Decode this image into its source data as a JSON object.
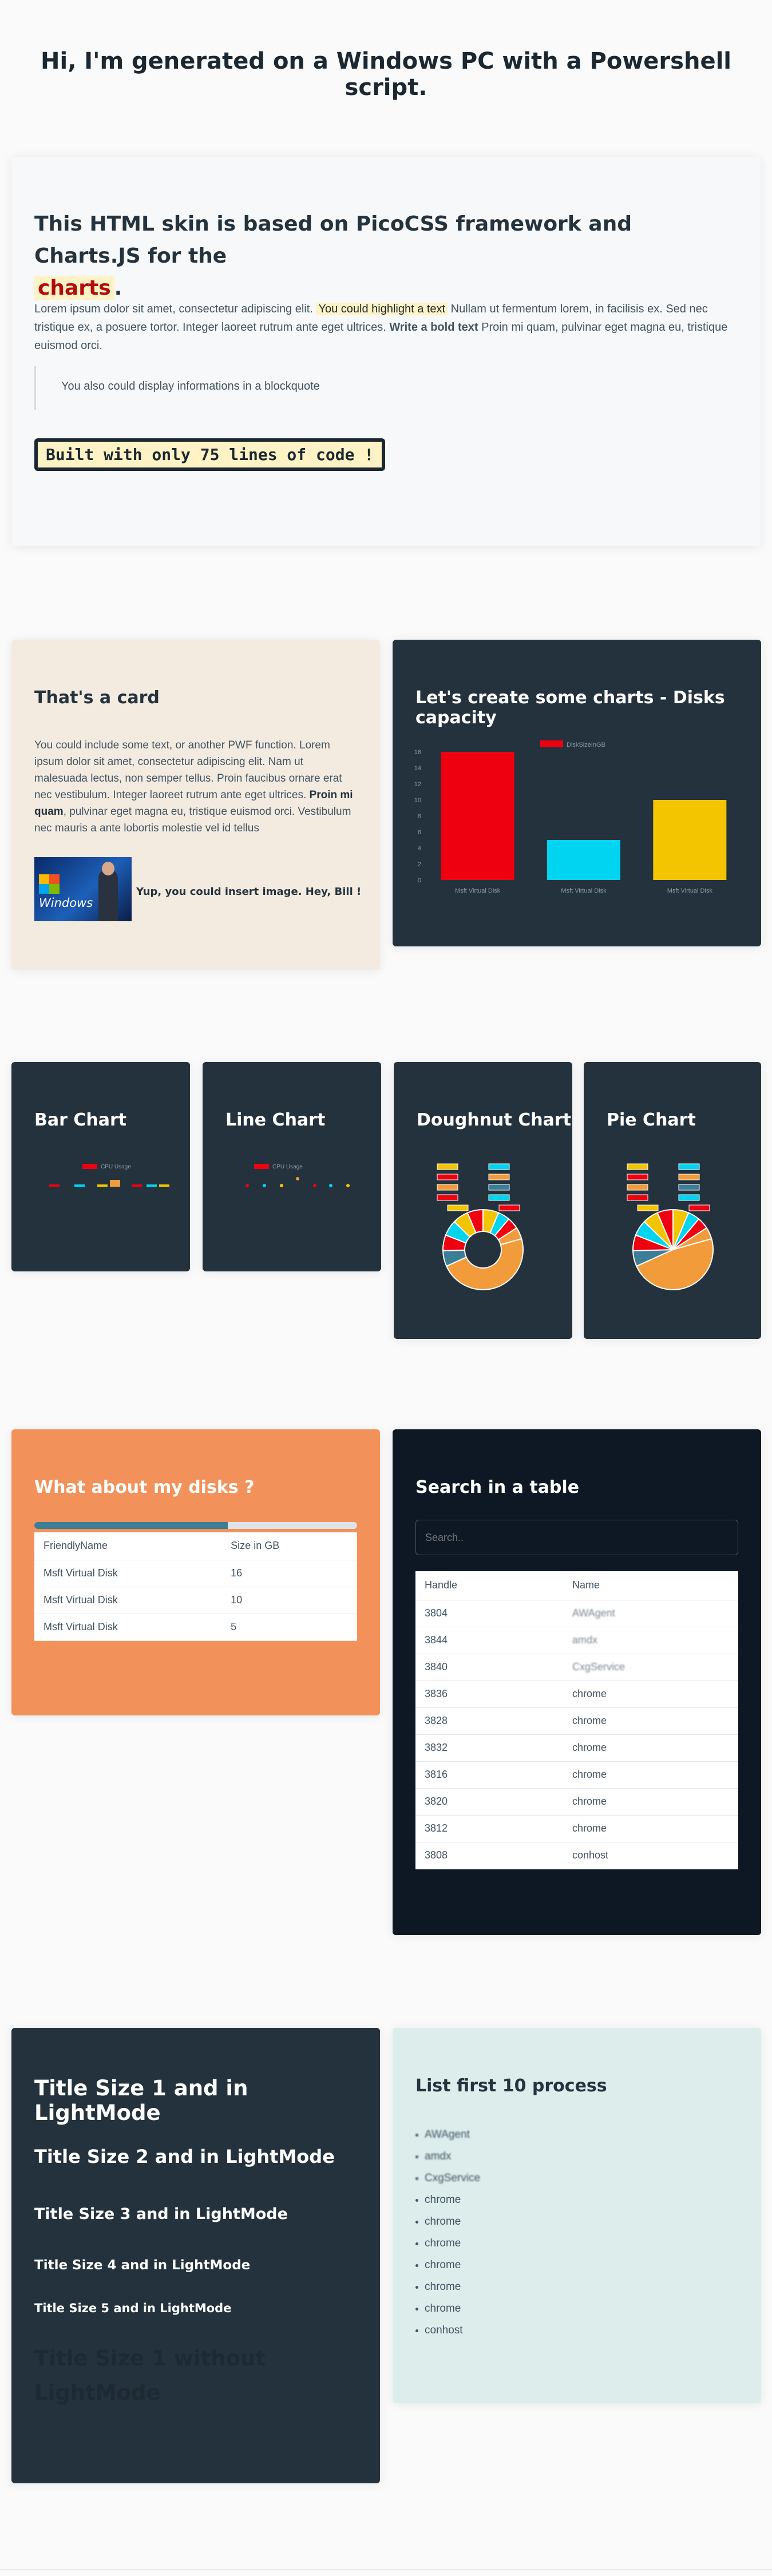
{
  "page_title": "Hi, I'm generated on a Windows PC with a Powershell script.",
  "hero": {
    "title_prefix": "This HTML skin is based on",
    "title_pico": "PicoCSS framework",
    "title_and": "and",
    "title_chartjs": "Charts.JS",
    "title_for": "for the",
    "title_charts": "charts",
    "title_dot": ".",
    "para_1": "Lorem ipsum dolor sit amet, consectetur adipiscing elit.",
    "para_highlight": "You could highlight a text",
    "para_2": "Nullam ut fermentum lorem, in facilisis ex. Sed nec tristique ex, a posuere tortor. Integer laoreet rutrum ante eget ultrices.",
    "para_bold": "Write a bold text",
    "para_3": "Proin mi quam, pulvinar eget magna eu, tristique euismod orci.",
    "blockquote": "You also could display informations in a blockquote",
    "code": "Built with only 75 lines of code !"
  },
  "card1": {
    "title": "That's a card",
    "text_1": "You could include some text, or another PWF function. Lorem ipsum dolor sit amet, consectetur adipiscing elit. Nam ut malesuada lectus, non semper tellus. Proin faucibus ornare erat nec vestibulum. Integer laoreet rutrum ante eget ultrices.",
    "text_bold": "Proin mi quam",
    "text_2": ", pulvinar eget magna eu, tristique euismod orci. Vestibulum nec mauris a ante lobortis molestie vel id tellus",
    "image_text": "Windows",
    "image_caption": "Yup, you could insert image. Hey, Bill !"
  },
  "disk_chart": {
    "title": "Let's create some charts - Disks capacity",
    "legend": "DiskSizeInGB",
    "color_primary": "#ef0010"
  },
  "chart_data": [
    {
      "type": "bar",
      "title": "Let's create some charts - Disks capacity",
      "series": [
        {
          "name": "DiskSizeInGB",
          "values": [
            16,
            5,
            10
          ]
        }
      ],
      "categories": [
        "Msft Virtual Disk",
        "Msft Virtual Disk",
        "Msft Virtual Disk"
      ],
      "colors": [
        "#ef0010",
        "#00d4f0",
        "#f2c500"
      ],
      "ylim": [
        0,
        16
      ],
      "yticks": [
        "0",
        "2",
        "4",
        "6",
        "8",
        "10",
        "12",
        "14",
        "16"
      ],
      "grid": false,
      "legend": "top"
    }
  ],
  "small_charts": [
    {
      "title": "Bar Chart",
      "legend": "CPU Usage"
    },
    {
      "title": "Line Chart",
      "legend": "CPU Usage"
    },
    {
      "title": "Doughnut Chart"
    },
    {
      "title": "Pie Chart"
    }
  ],
  "disks_card": {
    "title": "What about my disks ?",
    "progress": 0.6,
    "headers": [
      "FriendlyName",
      "Size in GB"
    ],
    "rows": [
      [
        "Msft Virtual Disk",
        "16"
      ],
      [
        "Msft Virtual Disk",
        "10"
      ],
      [
        "Msft Virtual Disk",
        "5"
      ]
    ]
  },
  "search_card": {
    "title": "Search in a table",
    "placeholder": "Search..",
    "headers": [
      "Handle",
      "Name"
    ],
    "rows": [
      [
        "3804",
        "AWAgent"
      ],
      [
        "3844",
        "amdx"
      ],
      [
        "3840",
        "CxgService"
      ],
      [
        "3836",
        "chrome"
      ],
      [
        "3828",
        "chrome"
      ],
      [
        "3832",
        "chrome"
      ],
      [
        "3816",
        "chrome"
      ],
      [
        "3820",
        "chrome"
      ],
      [
        "3812",
        "chrome"
      ],
      [
        "3808",
        "conhost"
      ]
    ]
  },
  "titles_card": {
    "t1": "Title Size 1 and in LightMode",
    "t2": "Title Size 2 and in LightMode",
    "t3": "Title Size 3 and in LightMode",
    "t4": "Title Size 4 and in LightMode",
    "t5": "Title Size 5 and in LightMode",
    "t6": "Title Size 1 without LightMode"
  },
  "process_card": {
    "title": "List first 10 process",
    "items": [
      "AWAgent",
      "amdx",
      "CxgService",
      "chrome",
      "chrome",
      "chrome",
      "chrome",
      "chrome",
      "chrome",
      "conhost"
    ]
  }
}
